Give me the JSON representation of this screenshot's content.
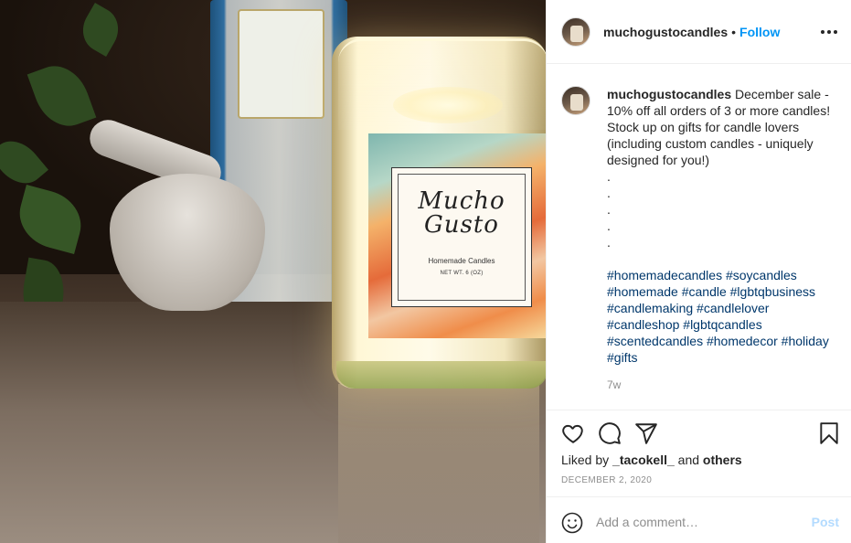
{
  "post": {
    "username": "muchogustocandles",
    "separator": "•",
    "follow_label": "Follow",
    "caption_body": "December sale - 10% off all orders of 3 or more candles! Stock up on gifts for candle lovers (including custom candles - uniquely designed for you!)\n.\n.\n.\n.\n.",
    "hashtags": "#homemadecandles #soycandles\n#homemade #candle #lgbtqbusiness\n#candlemaking #candlelover\n#candleshop #lgbtqcandles\n#scentedcandles #homedecor #holiday\n#gifts",
    "time_ago": "7w",
    "liked_prefix": "Liked by",
    "liked_user": "_tacokell_",
    "liked_and": "and",
    "liked_others": "others",
    "date": "DECEMBER 2, 2020"
  },
  "comment_box": {
    "placeholder": "Add a comment…",
    "post_label": "Post"
  },
  "photo_label": {
    "brand": "Mucho\nGusto",
    "subtitle": "Homemade Candles",
    "weight": "NET WT. 6 (OZ)"
  },
  "icons": {
    "like": "heart-icon",
    "comment": "comment-icon",
    "share": "share-icon",
    "save": "bookmark-icon",
    "more": "more-options-icon",
    "emoji": "emoji-icon"
  },
  "colors": {
    "follow": "#0095f6",
    "hashtag": "#00376b",
    "muted": "#8e8e8e",
    "post_disabled": "#b3dbff"
  }
}
